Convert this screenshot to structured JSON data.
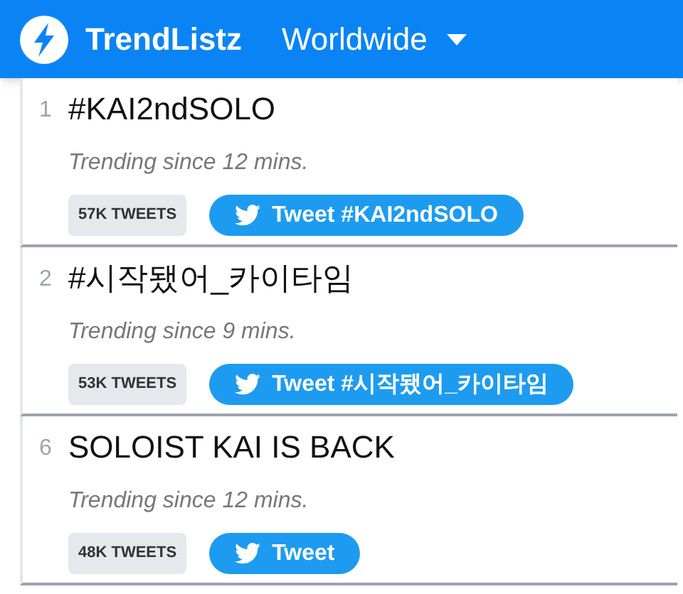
{
  "header": {
    "app_name": "TrendListz",
    "region": "Worldwide"
  },
  "trends": [
    {
      "rank": "1",
      "name": "#KAI2ndSOLO",
      "since": "Trending since 12 mins.",
      "count": "57K TWEETS",
      "button": "Tweet #KAI2ndSOLO"
    },
    {
      "rank": "2",
      "name": "#시작됐어_카이타임",
      "since": "Trending since 9 mins.",
      "count": "53K TWEETS",
      "button": "Tweet #시작됐어_카이타임"
    },
    {
      "rank": "6",
      "name": "SOLOIST KAI IS BACK",
      "since": "Trending since 12 mins.",
      "count": "48K TWEETS",
      "button": "Tweet"
    }
  ]
}
